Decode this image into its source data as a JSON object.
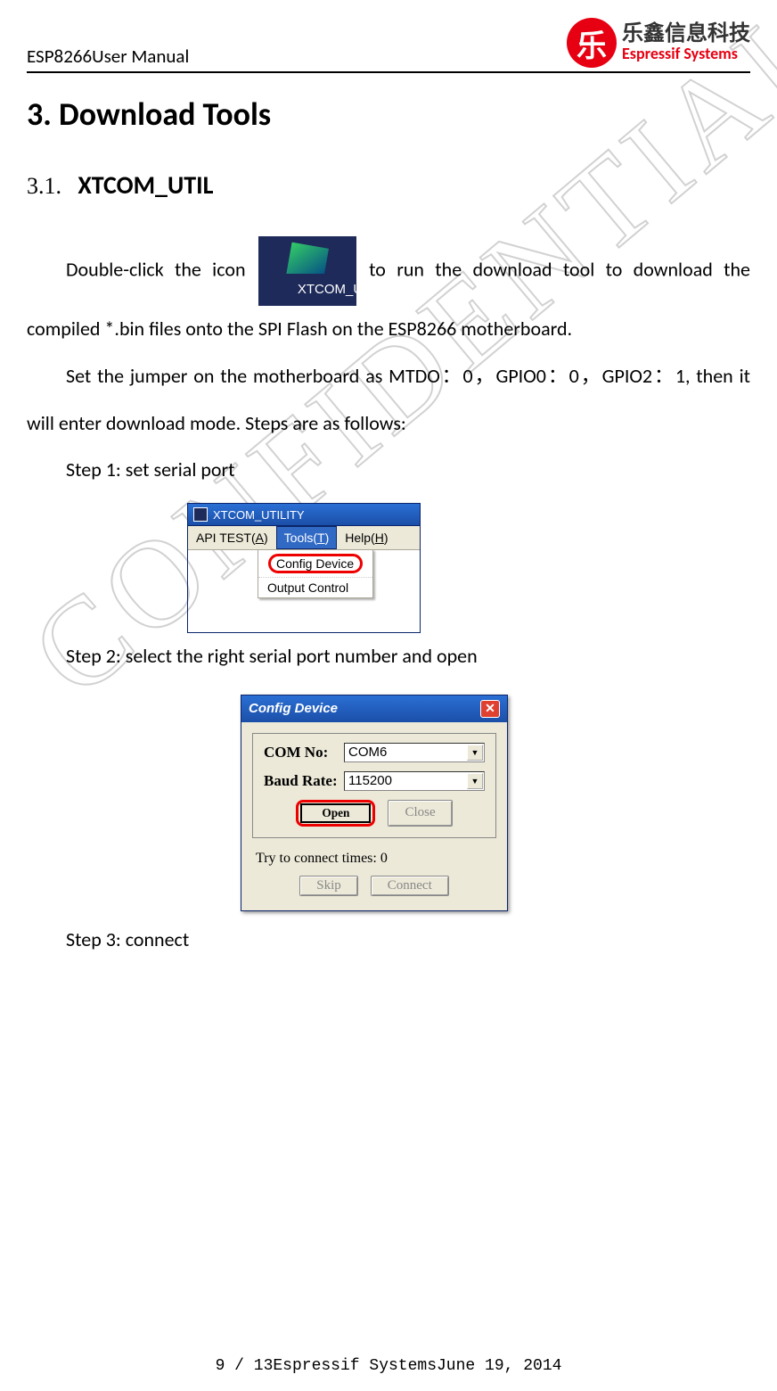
{
  "header": {
    "doc_title": "ESP8266User Manual",
    "logo_cn": "乐鑫信息科技",
    "logo_en": "Espressif Systems"
  },
  "watermark": "CONFIDENTIAL",
  "h1": "3. Download Tools",
  "h2_num": "3.1.",
  "h2_title": "XTCOM_UTIL",
  "icon_caption": "XTCOM_UTIL",
  "p1a": "Double-click  the  icon",
  "p1b": "  to  run  the  download  tool  to  download  the compiled *.bin files onto the SPI Flash on the ESP8266 motherboard.",
  "p2": "Set the jumper on the motherboard as MTDO：0，GPIO0：0，GPIO2：1, then it will enter download mode. Steps are as follows:",
  "step1": "Step 1: set serial port",
  "step2": "Step 2: select the right serial port number and open",
  "step3": "Step 3: connect",
  "win1": {
    "title": "XTCOM_UTILITY",
    "menu_api": "API TEST(A)",
    "menu_tools_label": "Tools(T)",
    "menu_tools_ul": "T",
    "menu_help_label": "Help(H)",
    "menu_help_ul": "H",
    "dd_config": "Config Device",
    "dd_output": "Output Control"
  },
  "dlg": {
    "title": "Config Device",
    "com_label": "COM No:",
    "com_value": "COM6",
    "baud_label": "Baud Rate:",
    "baud_value": "115200",
    "open": "Open",
    "close": "Close",
    "try_text": "Try to connect times: 0",
    "skip": "Skip",
    "connect": "Connect"
  },
  "footer": "9 / 13Espressif SystemsJune 19, 2014"
}
